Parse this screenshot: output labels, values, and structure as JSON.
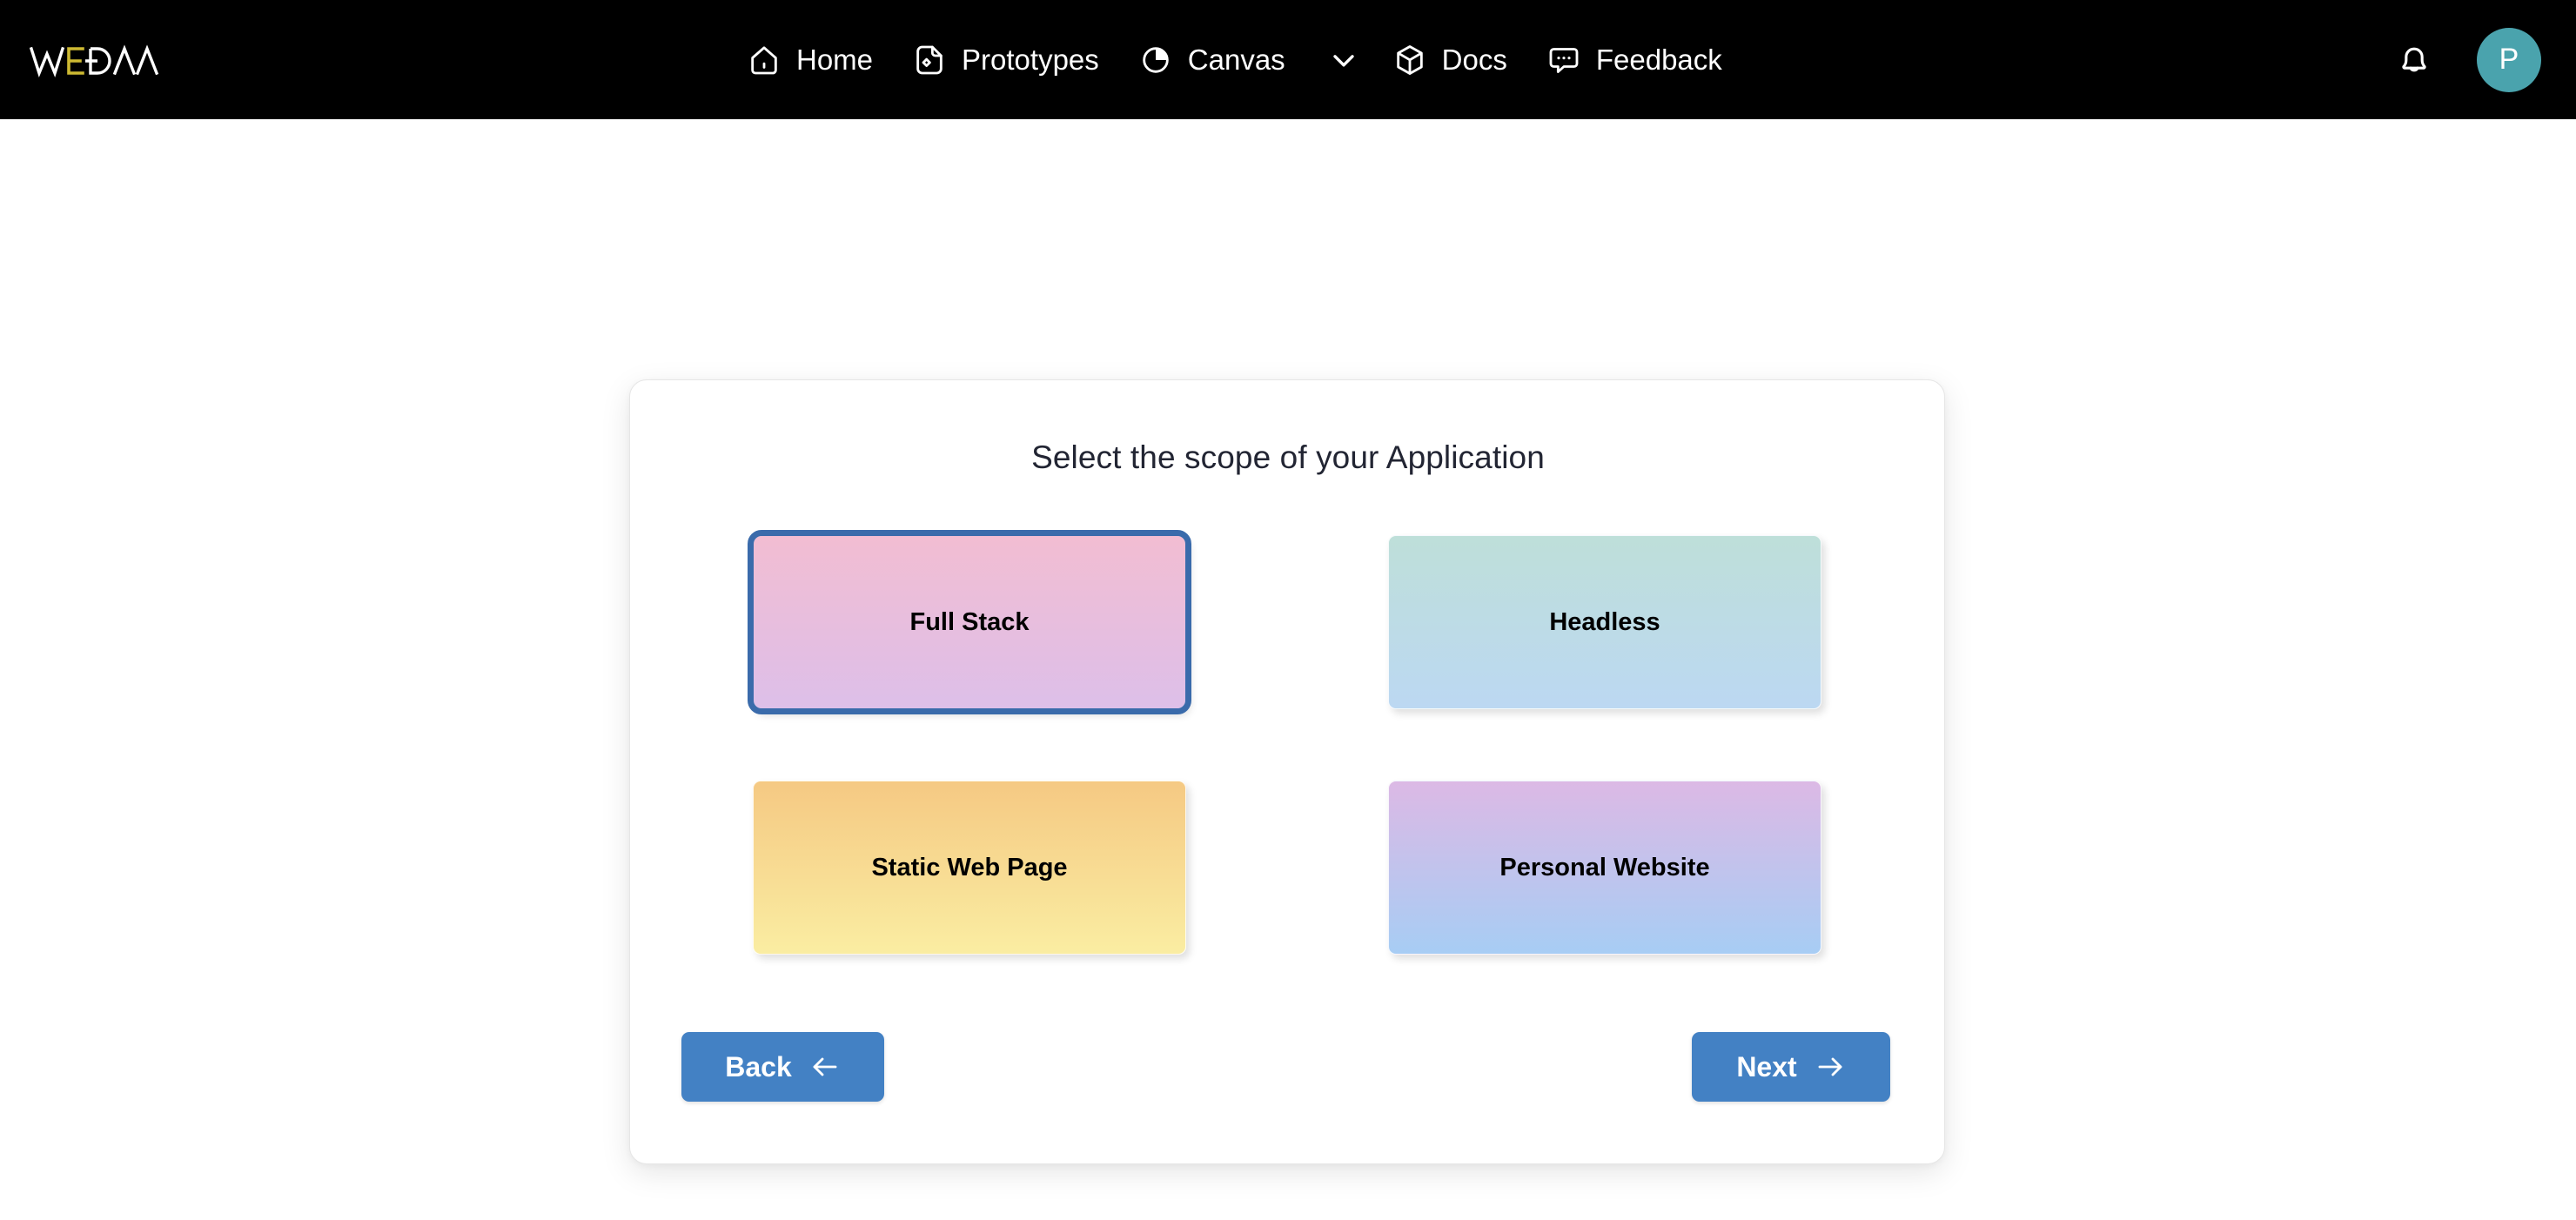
{
  "app": {
    "logo_text": "WEDAA",
    "logo_accent_color": "#cdb932",
    "background_color": "#ffffff",
    "topbar_color": "#000000"
  },
  "nav": {
    "items": [
      {
        "label": "Home",
        "icon": "home-icon"
      },
      {
        "label": "Prototypes",
        "icon": "file-prototype-icon"
      },
      {
        "label": "Canvas",
        "icon": "canvas-pie-icon",
        "has_dropdown": true,
        "dropdown_icon": "chevron-down-icon"
      },
      {
        "label": "Docs",
        "icon": "cube-docs-icon"
      },
      {
        "label": "Feedback",
        "icon": "chat-bubble-icon"
      }
    ],
    "right": {
      "notification_icon": "bell-icon",
      "avatar_initial": "P",
      "avatar_color": "#4aa3ad"
    }
  },
  "panel": {
    "title": "Select the scope of your Application",
    "options": [
      {
        "label": "Full Stack",
        "selected": true,
        "gradient_from": "#f2bdd2",
        "gradient_to": "#ddbfe9"
      },
      {
        "label": "Headless",
        "selected": false,
        "gradient_from": "#bedfd9",
        "gradient_to": "#bcd8f2"
      },
      {
        "label": "Static Web Page",
        "selected": false,
        "gradient_from": "#f5c983",
        "gradient_to": "#faeda2"
      },
      {
        "label": "Personal Website",
        "selected": false,
        "gradient_from": "#dcb9e5",
        "gradient_to": "#a7cdf4"
      }
    ],
    "selection_border_color": "#3a6bab",
    "buttons": {
      "back_label": "Back",
      "back_icon": "arrow-left-icon",
      "next_label": "Next",
      "next_icon": "arrow-right-icon",
      "button_color": "#4381c4"
    }
  }
}
